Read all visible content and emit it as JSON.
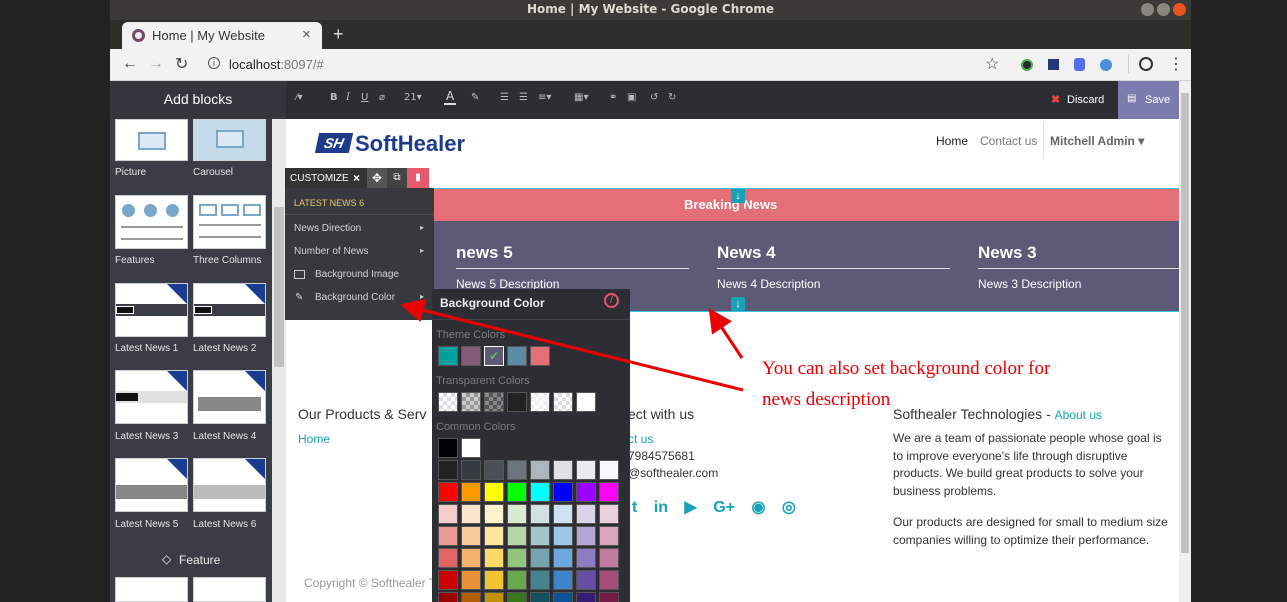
{
  "window": {
    "title": "Home | My Website - Google Chrome"
  },
  "tab": {
    "title": "Home | My Website",
    "close": "×",
    "new_tab": "+"
  },
  "address": {
    "host": "localhost",
    "rest": ":8097/#"
  },
  "sidebar": {
    "title": "Add blocks",
    "blocks": [
      {
        "label": "Picture"
      },
      {
        "label": "Carousel"
      },
      {
        "label": "Features"
      },
      {
        "label": "Three Columns"
      },
      {
        "label": "Latest News 1"
      },
      {
        "label": "Latest News 2"
      },
      {
        "label": "Latest News 3"
      },
      {
        "label": "Latest News 4"
      },
      {
        "label": "Latest News 5"
      },
      {
        "label": "Latest News 6"
      }
    ],
    "section": "Feature"
  },
  "toolbar": {
    "font_size": "21",
    "discard": "Discard",
    "save": "Save"
  },
  "site": {
    "logo": "SoftHealer",
    "nav": {
      "home": "Home",
      "contact": "Contact us",
      "user": "Mitchell Admin"
    },
    "breaking": "Breaking News",
    "news": [
      {
        "title": "news 5",
        "desc": "News 5 Description"
      },
      {
        "title": "News 4",
        "desc": "News 4 Description"
      },
      {
        "title": "News 3",
        "desc": "News 3 Description"
      }
    ],
    "footer": {
      "col1_title": "Our Products & Serv",
      "col1_link": "Home",
      "col2_title": "ect with us",
      "col2_link": "ct us",
      "col2_phone": "7984575681",
      "col2_email": "@softhealer.com",
      "col3_title": "Softhealer Technologies",
      "col3_sep": " - ",
      "col3_link": "About us",
      "col3_p1": "We are a team of passionate people whose goal is to improve everyone's life through disruptive products. We build great products to solve your business problems.",
      "col3_p2": "Our products are designed for small to medium size companies willing to optimize their performance.",
      "copyright": "Copyright © Softhealer T"
    }
  },
  "customize": {
    "label": "CUSTOMIZE",
    "close": "×"
  },
  "ctxmenu": {
    "header": "LATEST NEWS 6",
    "items": [
      "News Direction",
      "Number of News",
      "Background Image",
      "Background Color"
    ]
  },
  "bgpanel": {
    "title": "Background Color",
    "theme": "Theme Colors",
    "transparent": "Transparent Colors",
    "common": "Common Colors",
    "theme_colors": [
      "#00a09d",
      "#875a7b",
      "#5b5a77",
      "#5c8aa5",
      "#e46f78"
    ],
    "common_grid": [
      [
        "#000000",
        "#ffffff"
      ],
      [
        "#212121",
        "#343a40",
        "#495057",
        "#6c757d",
        "#adb5bd",
        "#dee2e6",
        "#e9ecef",
        "#f8f9fa"
      ],
      [
        "#ff0000",
        "#ff9900",
        "#ffff00",
        "#00ff00",
        "#00ffff",
        "#0000ff",
        "#9900ff",
        "#ff00ff"
      ],
      [
        "#f4cccc",
        "#fce5cd",
        "#fff2cc",
        "#d9ead3",
        "#d0e0e3",
        "#cfe2f3",
        "#d9d2e9",
        "#ead1dc"
      ],
      [
        "#ea9999",
        "#f9cb9c",
        "#ffe599",
        "#b6d7a8",
        "#a2c4c9",
        "#9fc5e8",
        "#b4a7d6",
        "#d5a6bd"
      ],
      [
        "#e06666",
        "#f6b26b",
        "#ffd966",
        "#93c47d",
        "#76a5af",
        "#6fa8dc",
        "#8e7cc3",
        "#c27ba0"
      ],
      [
        "#cc0000",
        "#e69138",
        "#f1c232",
        "#6aa84f",
        "#45818e",
        "#3d85c6",
        "#674ea7",
        "#a64d79"
      ],
      [
        "#990000",
        "#b45f06",
        "#bf9000",
        "#38761d",
        "#134f5c",
        "#0b5394",
        "#351c75",
        "#741b47"
      ]
    ]
  },
  "annotation": {
    "line1": "You can also set background color for",
    "line2": "news description"
  }
}
